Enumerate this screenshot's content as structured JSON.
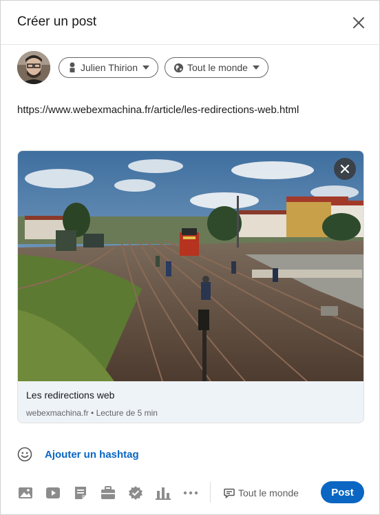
{
  "dialog": {
    "title": "Créer un post",
    "close_icon": "close-icon"
  },
  "author": {
    "name": "Julien Thirion",
    "audience": "Tout le monde",
    "person_icon": "person-icon",
    "globe_icon": "globe-icon"
  },
  "post": {
    "text": "https://www.webexmachina.fr/article/les-redirections-web.html"
  },
  "link_preview": {
    "title": "Les redirections web",
    "meta": "webexmachina.fr • Lecture de 5 min",
    "image": "railway-yard-photo"
  },
  "hashtag": {
    "label": "Ajouter un hashtag",
    "emoji_icon": "emoji-icon"
  },
  "footer": {
    "tools": [
      "photo-icon",
      "video-icon",
      "document-icon",
      "job-icon",
      "celebrate-icon",
      "poll-icon",
      "more-icon"
    ],
    "visibility_label": "Tout le monde",
    "visibility_icon": "comment-icon",
    "post_label": "Post"
  },
  "colors": {
    "brand_blue": "#0a66c2",
    "text": "#191919",
    "muted": "#666666"
  }
}
